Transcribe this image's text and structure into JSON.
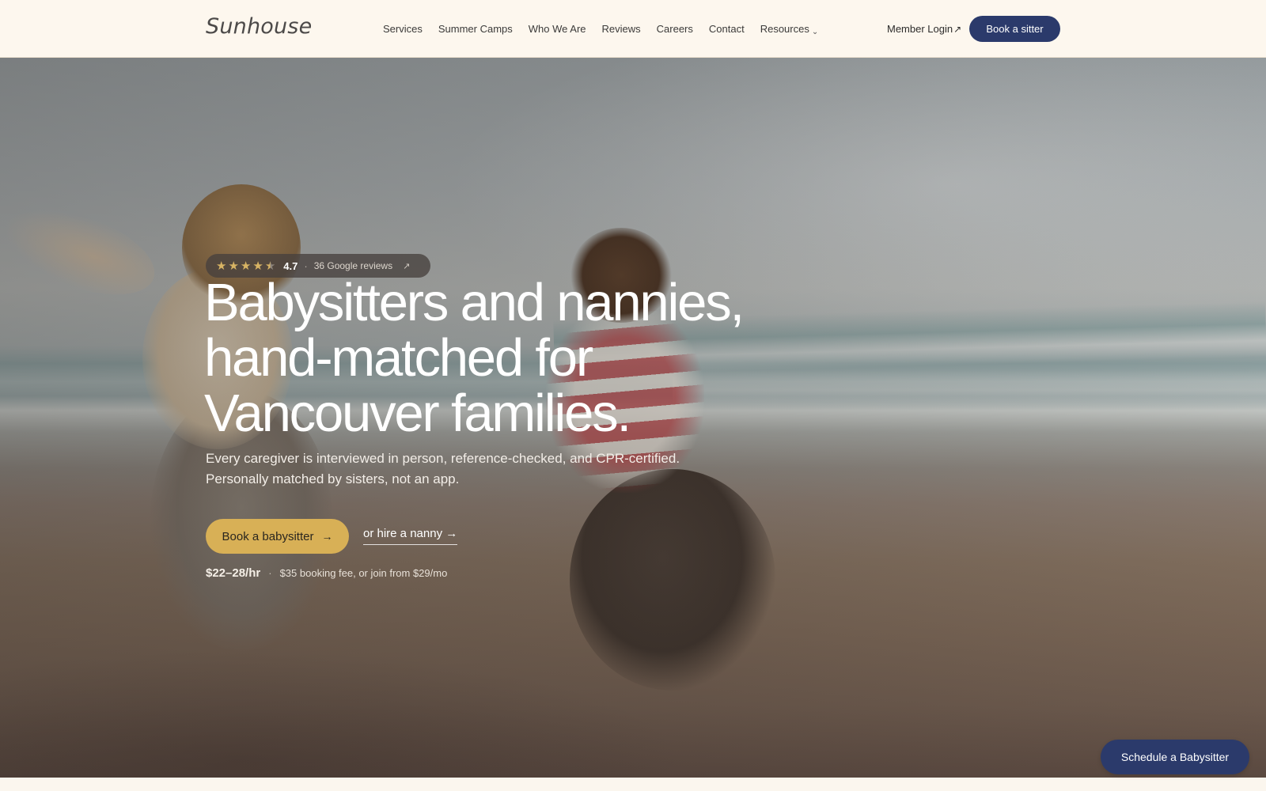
{
  "header": {
    "logo": "Sunhouse",
    "nav": [
      "Services",
      "Summer Camps",
      "Who We Are",
      "Reviews",
      "Careers",
      "Contact",
      "Resources"
    ],
    "member_login": "Member Login",
    "book_sitter": "Book a sitter"
  },
  "hero": {
    "rating": {
      "stars": 4.5,
      "value": "4.7",
      "reviews": "36 Google reviews"
    },
    "headline": "Babysitters and nannies, hand-matched for Vancouver families.",
    "subtext": "Every caregiver is interviewed in person, reference-checked, and CPR-certified. Personally matched by sisters, not an app.",
    "cta_primary": "Book a babysitter",
    "cta_secondary": "or hire a nanny",
    "price": "$22–28/hr",
    "price_note": "$35 booking fee, or join from $29/mo"
  },
  "floating": {
    "schedule": "Schedule a Babysitter"
  },
  "colors": {
    "accent": "#d8b056",
    "navy": "#2b3a6b",
    "cream": "#fdf7ee",
    "star": "#d8b464"
  },
  "icons": {
    "external": "arrow-up-right-icon",
    "dropdown": "chevron-down-icon",
    "arrow": "arrow-right-icon",
    "star": "star-icon"
  }
}
